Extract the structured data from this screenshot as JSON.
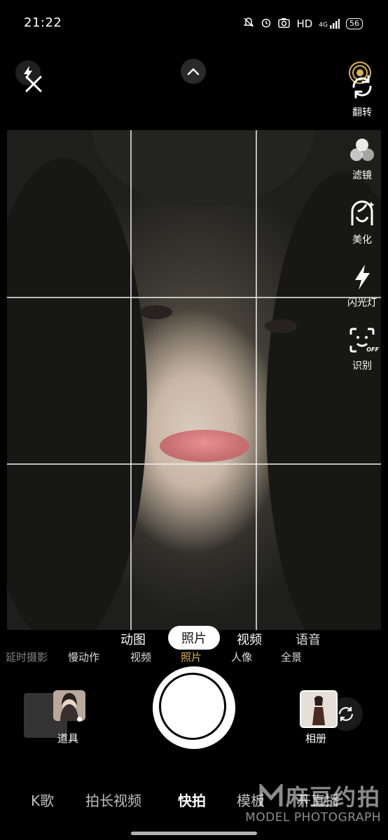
{
  "status_bar": {
    "time": "21:22",
    "hd": "HD",
    "network": "4G",
    "battery": "56"
  },
  "top": {
    "flip_label": "翻转"
  },
  "side_tools": [
    {
      "label": "滤镜",
      "icon": "filter-icon"
    },
    {
      "label": "美化",
      "icon": "beauty-icon"
    },
    {
      "label": "闪光灯",
      "icon": "flash-icon"
    },
    {
      "label": "识别",
      "icon": "face-recognition-icon",
      "badge": "OFF"
    }
  ],
  "modes": {
    "main": [
      "动图",
      "照片",
      "视频",
      "语音"
    ],
    "selected": "照片",
    "sub": [
      "延时摄影",
      "慢动作",
      "视频",
      "照片",
      "人像",
      "全景"
    ],
    "sub_active": "照片"
  },
  "bottom": {
    "props_label": "道具",
    "album_label": "相册"
  },
  "nav": {
    "items": [
      "K歌",
      "拍长视频",
      "快拍",
      "模板",
      "开直播"
    ],
    "active": "快拍"
  },
  "watermark": {
    "cn": "麻豆约拍",
    "en": "MODEL PHOTOGRAPH"
  },
  "colors": {
    "accent_gold": "#d9b34a",
    "background": "#000000"
  }
}
